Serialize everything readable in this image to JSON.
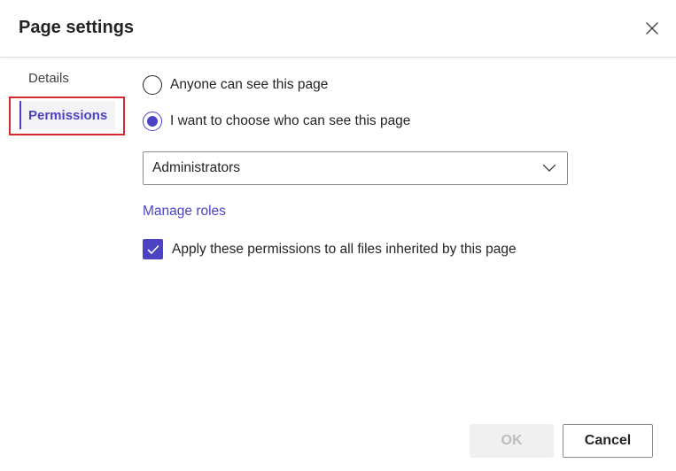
{
  "dialog": {
    "title": "Page settings"
  },
  "nav": {
    "items": [
      {
        "label": "Details",
        "selected": false
      },
      {
        "label": "Permissions",
        "selected": true
      }
    ]
  },
  "permissions": {
    "options": [
      {
        "label": "Anyone can see this page",
        "checked": false
      },
      {
        "label": "I want to choose who can see this page",
        "checked": true
      }
    ],
    "roles_select": {
      "value": "Administrators"
    },
    "manage_roles_link": "Manage roles",
    "apply_checkbox": {
      "label": "Apply these permissions to all files inherited by this page",
      "checked": true
    }
  },
  "footer": {
    "ok_label": "OK",
    "ok_disabled": true,
    "cancel_label": "Cancel"
  },
  "colors": {
    "accent": "#4b43c4",
    "highlight": "#d32a2f"
  },
  "icons": {
    "close": "close-icon",
    "chevron": "chevron-down-icon",
    "check": "checkmark-icon"
  }
}
